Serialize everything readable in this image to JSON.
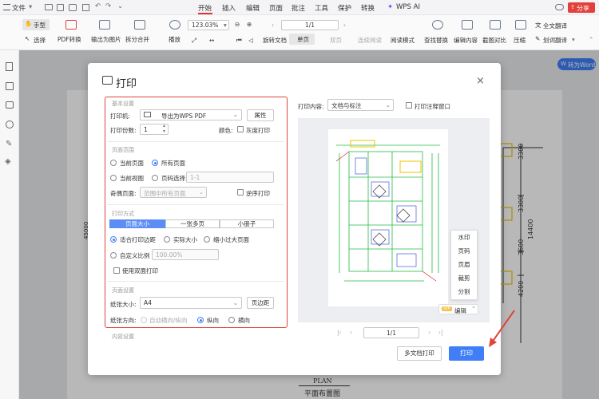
{
  "menubar": {
    "file": "文件",
    "tabs": [
      "开始",
      "插入",
      "编辑",
      "页面",
      "批注",
      "工具",
      "保护",
      "转换"
    ],
    "ai": "WPS AI",
    "share": "分享"
  },
  "toolbar": {
    "hand": "手型",
    "select": "选择",
    "pdf_convert": "PDF转换",
    "export_image": "输出为图片",
    "split_merge": "拆分合并",
    "play": "播放",
    "zoom": "123.03%",
    "page": "1/1",
    "rotate": "旋转文档",
    "single": "单页",
    "double": "双页",
    "continuous": "连续阅读",
    "read_mode": "阅读模式",
    "find_replace": "查找替换",
    "edit_content": "编辑内容",
    "screenshot_compare": "截图对比",
    "compress": "压缩",
    "full_translate": "全文翻译",
    "word_translate": "划词翻译",
    "to_word": "转为Word"
  },
  "background": {
    "plan_label": "PLAN",
    "plan_title": "平面布置图",
    "dims": [
      "3300",
      "3300",
      "14400",
      "3600",
      "4200"
    ],
    "left_dim": "45000"
  },
  "dialog": {
    "title": "打印",
    "close": "×",
    "basic_section": "基本设置",
    "printer_label": "打印机:",
    "printer_value": "导出为WPS PDF",
    "properties_btn": "属性",
    "copies_label": "打印份数:",
    "copies_value": "1",
    "color_label": "颜色:",
    "grayscale": "灰度打印",
    "range_section": "页面范围",
    "current_page": "当前页面",
    "all_pages": "所有页面",
    "current_view": "当前视图",
    "page_select": "页码选择:",
    "page_select_placeholder": "1-1",
    "odd_even_label": "奇偶页面:",
    "odd_even_value": "范围中所有页面",
    "reverse": "逆序打印",
    "mode_section": "打印方式",
    "mode_tabs": [
      "页面大小",
      "一张多页",
      "小册子"
    ],
    "fit_margin": "适合打印边距",
    "actual_size": "实际大小",
    "shrink_large": "缩小过大页面",
    "custom_scale": "自定义比例",
    "scale_value": "100.00%",
    "duplex": "使用双面打印",
    "page_section": "页面设置",
    "paper_size_label": "纸张大小:",
    "paper_size_value": "A4",
    "margin_btn": "页边距",
    "orientation_label": "纸张方向:",
    "auto_orientation": "自动横向/纵向",
    "portrait": "纵向",
    "landscape": "横向",
    "content_section": "内容设置",
    "print_content_label": "打印内容:",
    "print_content_value": "文档与标注",
    "print_annotation_window": "打印注释窗口",
    "preview_page": "1/1",
    "ctx_menu": [
      "水印",
      "页码",
      "页眉",
      "裁剪",
      "分割"
    ],
    "vip_badge": "VIP",
    "edit_label": "编辑",
    "multi_doc_print": "多文档打印",
    "print_btn": "打印"
  }
}
